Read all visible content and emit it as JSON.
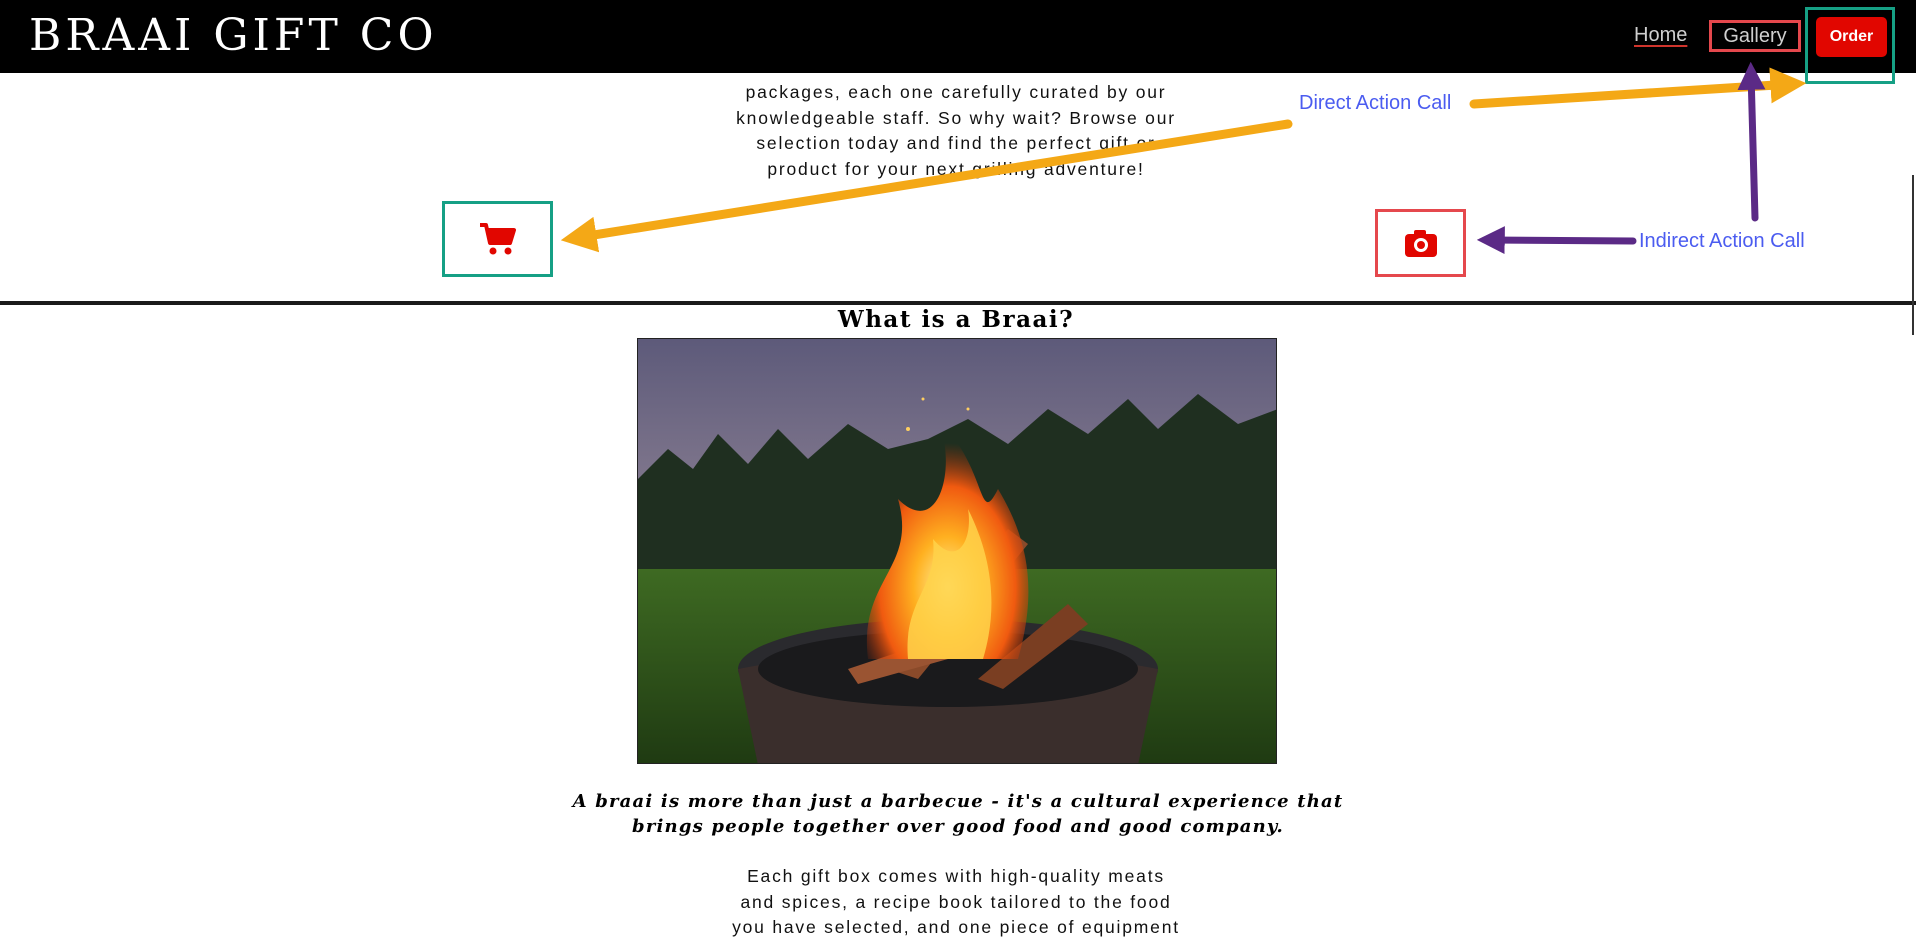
{
  "header": {
    "brand": "BRAAI GIFT CO",
    "nav": {
      "home": "Home",
      "gallery": "Gallery",
      "order": "Order"
    }
  },
  "intro": {
    "lines": [
      "packages, each one carefully curated by our",
      "knowledgeable staff. So why wait? Browse our",
      "selection today and find the perfect gift or",
      "product for your next grilling adventure!"
    ]
  },
  "annotations": {
    "direct": "Direct Action Call",
    "indirect": "Indirect Action Call"
  },
  "icons": {
    "cart": "cart-icon",
    "camera": "camera-icon"
  },
  "section": {
    "title": "What is a Braai?",
    "lead_lines": [
      "A braai is more than just a barbecue - it's a cultural experience that",
      "brings people together over good food and good company."
    ],
    "body_lines": [
      "Each gift box comes with high-quality meats",
      "and spices, a recipe book tailored to the food",
      "you have selected, and one piece of equipment"
    ]
  },
  "colors": {
    "accent_red": "#e10600",
    "teal_frame": "#16a085",
    "red_frame": "#e5484d",
    "arrow_orange": "#f4a816",
    "arrow_purple": "#5b2a86",
    "annotation_blue": "#4b5cf0"
  }
}
